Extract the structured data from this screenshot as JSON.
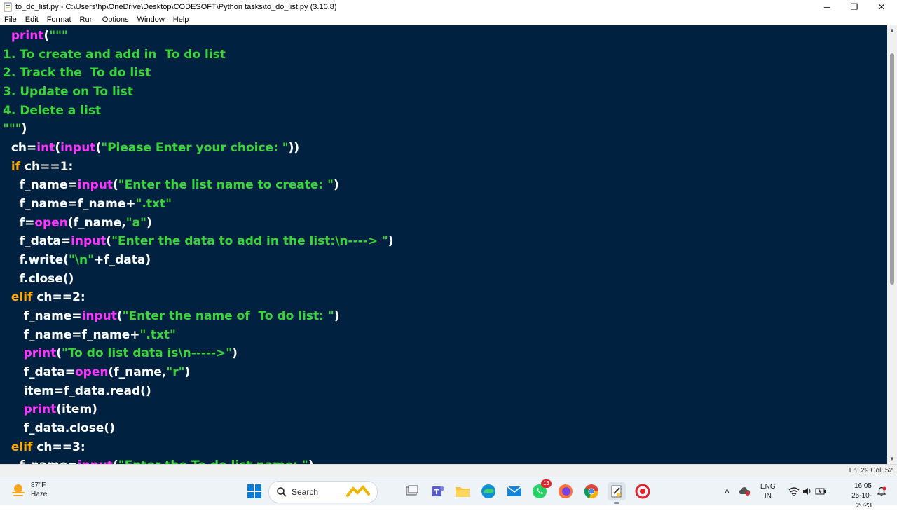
{
  "window": {
    "title": "to_do_list.py - C:\\Users\\hp\\OneDrive\\Desktop\\CODESOFT\\Python tasks\\to_do_list.py (3.10.8)",
    "minimize_icon": "─",
    "maximize_icon": "❐",
    "close_icon": "✕"
  },
  "menu": [
    "File",
    "Edit",
    "Format",
    "Run",
    "Options",
    "Window",
    "Help"
  ],
  "code_lines": [
    [
      {
        "c": "bi",
        "t": "  print"
      },
      {
        "c": "tx",
        "t": "("
      },
      {
        "c": "st",
        "t": "\"\"\""
      }
    ],
    [
      {
        "c": "st",
        "t": "1. To create and add in  To do list"
      }
    ],
    [
      {
        "c": "st",
        "t": "2. Track the  To do list"
      }
    ],
    [
      {
        "c": "st",
        "t": "3. Update on To list"
      }
    ],
    [
      {
        "c": "st",
        "t": "4. Delete a list"
      }
    ],
    [
      {
        "c": "st",
        "t": "\"\"\""
      },
      {
        "c": "tx",
        "t": ")"
      }
    ],
    [
      {
        "c": "tx",
        "t": "  ch="
      },
      {
        "c": "bi",
        "t": "int"
      },
      {
        "c": "tx",
        "t": "("
      },
      {
        "c": "bi",
        "t": "input"
      },
      {
        "c": "tx",
        "t": "("
      },
      {
        "c": "st",
        "t": "\"Please Enter your choice: \""
      },
      {
        "c": "tx",
        "t": "))"
      }
    ],
    [
      {
        "c": "kw",
        "t": "  if"
      },
      {
        "c": "tx",
        "t": " ch==1:"
      }
    ],
    [
      {
        "c": "tx",
        "t": "    f_name="
      },
      {
        "c": "bi",
        "t": "input"
      },
      {
        "c": "tx",
        "t": "("
      },
      {
        "c": "st",
        "t": "\"Enter the list name to create: \""
      },
      {
        "c": "tx",
        "t": ")"
      }
    ],
    [
      {
        "c": "tx",
        "t": "    f_name=f_name+"
      },
      {
        "c": "st",
        "t": "\".txt\""
      }
    ],
    [
      {
        "c": "tx",
        "t": "    f="
      },
      {
        "c": "bi",
        "t": "open"
      },
      {
        "c": "tx",
        "t": "(f_name,"
      },
      {
        "c": "st",
        "t": "\"a\""
      },
      {
        "c": "tx",
        "t": ")"
      }
    ],
    [
      {
        "c": "tx",
        "t": "    f_data="
      },
      {
        "c": "bi",
        "t": "input"
      },
      {
        "c": "tx",
        "t": "("
      },
      {
        "c": "st",
        "t": "\"Enter the data to add in the list:\\n----> \""
      },
      {
        "c": "tx",
        "t": ")"
      }
    ],
    [
      {
        "c": "tx",
        "t": "    f.write("
      },
      {
        "c": "st",
        "t": "\"\\n\""
      },
      {
        "c": "tx",
        "t": "+f_data)"
      }
    ],
    [
      {
        "c": "tx",
        "t": "    f.close()"
      }
    ],
    [
      {
        "c": "kw",
        "t": "  elif"
      },
      {
        "c": "tx",
        "t": " ch==2:"
      }
    ],
    [
      {
        "c": "tx",
        "t": "     f_name="
      },
      {
        "c": "bi",
        "t": "input"
      },
      {
        "c": "tx",
        "t": "("
      },
      {
        "c": "st",
        "t": "\"Enter the name of  To do list: \""
      },
      {
        "c": "tx",
        "t": ")"
      }
    ],
    [
      {
        "c": "tx",
        "t": "     f_name=f_name+"
      },
      {
        "c": "st",
        "t": "\".txt\""
      }
    ],
    [
      {
        "c": "bi",
        "t": "     print"
      },
      {
        "c": "tx",
        "t": "("
      },
      {
        "c": "st",
        "t": "\"To do list data is\\n----->\""
      },
      {
        "c": "tx",
        "t": ")"
      }
    ],
    [
      {
        "c": "tx",
        "t": "     f_data="
      },
      {
        "c": "bi",
        "t": "open"
      },
      {
        "c": "tx",
        "t": "(f_name,"
      },
      {
        "c": "st",
        "t": "\"r\""
      },
      {
        "c": "tx",
        "t": ")"
      }
    ],
    [
      {
        "c": "tx",
        "t": "     item=f_data.read()"
      }
    ],
    [
      {
        "c": "bi",
        "t": "     print"
      },
      {
        "c": "tx",
        "t": "(item)"
      }
    ],
    [
      {
        "c": "tx",
        "t": "     f_data.close()"
      }
    ],
    [
      {
        "c": "kw",
        "t": "  elif"
      },
      {
        "c": "tx",
        "t": " ch==3:"
      }
    ],
    [
      {
        "c": "tx",
        "t": "    f_name="
      },
      {
        "c": "bi",
        "t": "input"
      },
      {
        "c": "tx",
        "t": "("
      },
      {
        "c": "st",
        "t": "\"Enter the To do list name: \""
      },
      {
        "c": "tx",
        "t": ")"
      }
    ]
  ],
  "colors": {
    "editor_bg": "#002240",
    "keyword": "#ffa500",
    "builtin": "#ff33ff",
    "string": "#39d639",
    "text": "#ffffff"
  },
  "status": {
    "position": "Ln: 29   Col: 52"
  },
  "taskbar": {
    "weather_temp": "87°F",
    "weather_desc": "Haze",
    "search_label": "Search",
    "whatsapp_badge": "13",
    "lang_primary": "ENG",
    "lang_secondary": "IN",
    "time": "16:05",
    "date": "25-10-2023",
    "icons": [
      "windows-start-icon",
      "search-icon",
      "widgets-icon",
      "task-view-icon",
      "teams-icon",
      "file-explorer-icon",
      "edge-icon",
      "mail-icon",
      "whatsapp-icon",
      "firefox-icon",
      "chrome-icon",
      "idle-python-icon",
      "screen-recorder-icon"
    ]
  }
}
